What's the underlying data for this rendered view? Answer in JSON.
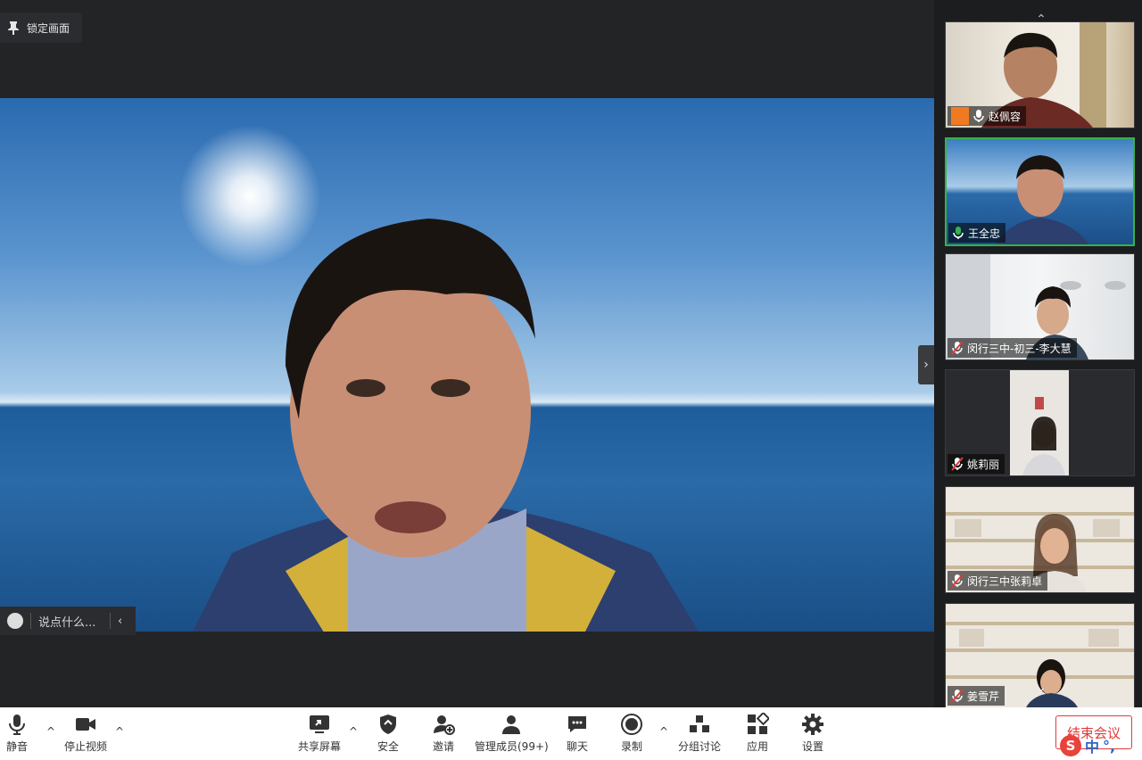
{
  "pin_label": "锁定画面",
  "chat_placeholder": "说点什么...",
  "participants": [
    {
      "name": "赵佩容",
      "mic": "on",
      "host_badge": true
    },
    {
      "name": "王全忠",
      "mic": "speaking",
      "active": true
    },
    {
      "name": "闵行三中-初三-李大慧",
      "mic": "muted"
    },
    {
      "name": "姚莉丽",
      "mic": "muted"
    },
    {
      "name": "闵行三中张莉卓",
      "mic": "muted"
    },
    {
      "name": "姜雪芹",
      "mic": "muted"
    }
  ],
  "toolbar": {
    "mute": "静音",
    "stop_video": "停止视频",
    "share_screen": "共享屏幕",
    "security": "安全",
    "invite": "邀请",
    "manage_members": "管理成员(99+)",
    "chat": "聊天",
    "record": "录制",
    "breakout": "分组讨论",
    "apps": "应用",
    "settings": "设置",
    "end_meeting": "结束会议"
  },
  "ime": {
    "lang": "中",
    "punct": "°,"
  },
  "colors": {
    "active_border": "#35b24b",
    "end_red": "#e03a3a",
    "host_orange": "#f07a22"
  }
}
